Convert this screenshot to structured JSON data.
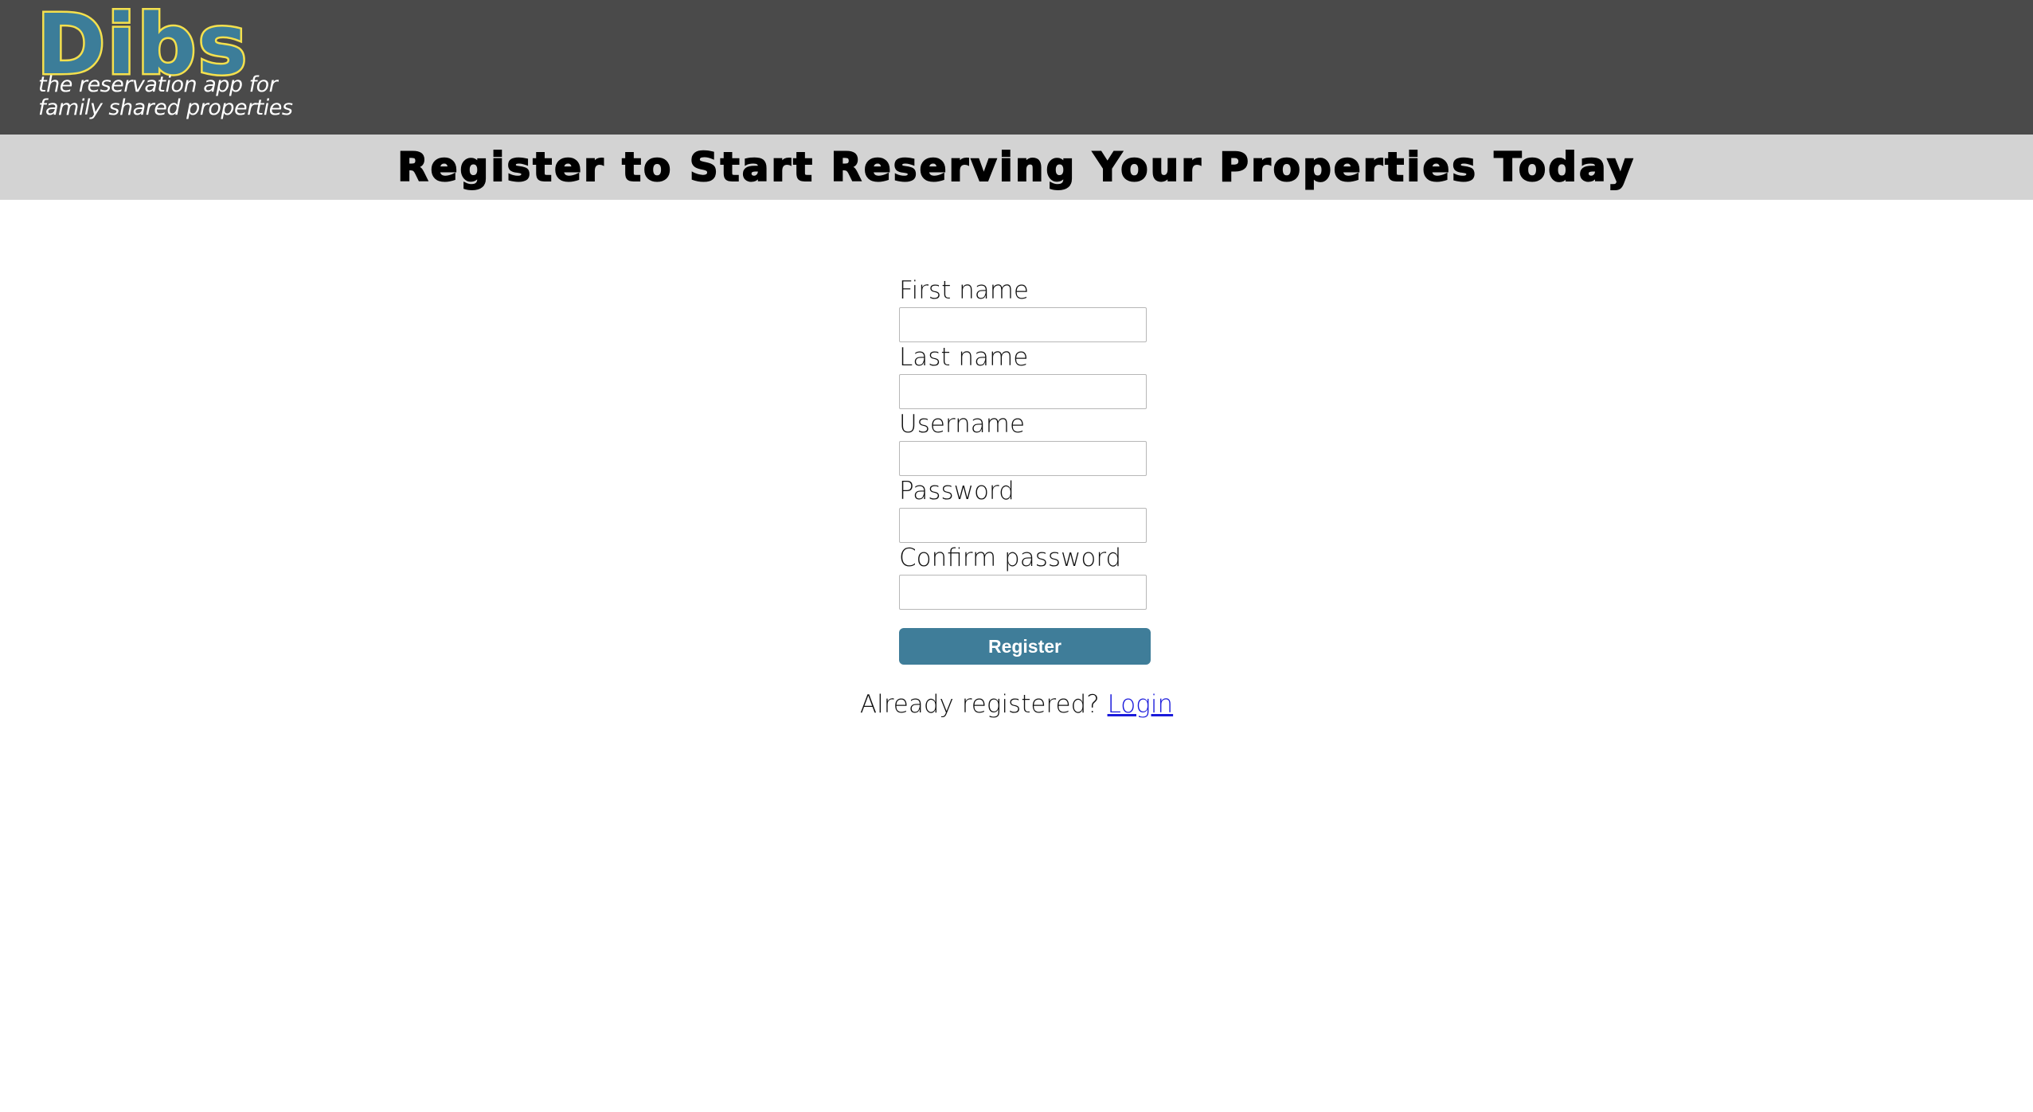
{
  "header": {
    "logo_text": "Dibs",
    "tagline_line1": "the reservation app for",
    "tagline_line2": "family shared properties",
    "colors": {
      "bar": "#4a4a4a",
      "logo_fill": "#3c7d99",
      "logo_outline": "#f4e04d"
    }
  },
  "banner": {
    "title": "Register to Start Reserving Your Properties Today",
    "background": "#d3d3d3"
  },
  "form": {
    "fields": [
      {
        "label": "First name",
        "value": ""
      },
      {
        "label": "Last name",
        "value": ""
      },
      {
        "label": "Username",
        "value": ""
      },
      {
        "label": "Password",
        "value": ""
      },
      {
        "label": "Confirm password",
        "value": ""
      }
    ],
    "submit_label": "Register",
    "submit_color": "#3f7d99"
  },
  "footer": {
    "prompt": "Already registered?",
    "link_label": "Login"
  }
}
